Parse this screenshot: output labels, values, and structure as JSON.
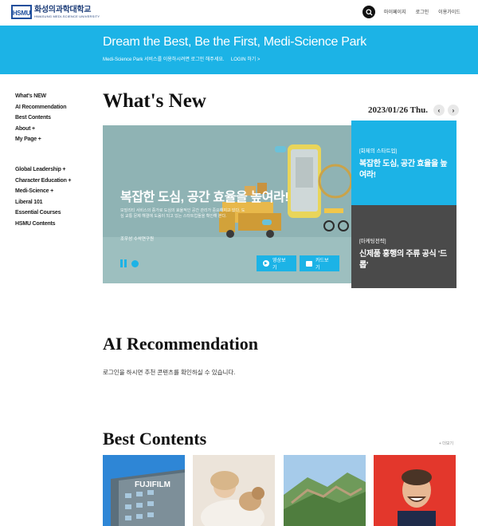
{
  "header": {
    "logo_mark": "HSMU",
    "logo_korean": "화성의과학대학교",
    "logo_english": "HWASUNG MEDI-SCIENCE UNIVERSITY",
    "links": [
      "마이페이지",
      "로그인",
      "이용가이드"
    ]
  },
  "banner": {
    "title": "Dream the Best, Be the First, Medi-Science Park",
    "subtitle": "Medi-Science Park 서비스를 이용하시려면 로그인 해주세요.     LOGIN 하기 >"
  },
  "sidebar": {
    "group1": [
      "What's NEW",
      "AI Recommendation",
      "Best Contents",
      "About +",
      "My Page +"
    ],
    "group2": [
      "Global Leadership +",
      "Character Education +",
      "Medi-Science +",
      "Liberal 101",
      "Essential Courses",
      "HSMU Contents"
    ]
  },
  "whats_new": {
    "title": "What's New",
    "date": "2023/01/26 Thu.",
    "hero": {
      "title": "복잡한 도심, 공간 효율을 높여라!",
      "description": "모빌리티 서비스의 증가로 도심의 효율적인 공간 관리가 중요해지고 있다. 도심 교통 문제 해결에 도움이 되고 있는 스타트업들을 확인해 본다.",
      "author": "조우성 수석연구원",
      "video_button": "영상보기",
      "card_button": "카드보기"
    },
    "cards": [
      {
        "tag": "[화제의 스타트업]",
        "title": "복잡한 도심, 공간 효율을 높여라!"
      },
      {
        "tag": "[마케팅전략]",
        "title": "신제품 흥행의 주류 공식 '드롭'"
      }
    ]
  },
  "ai_recommendation": {
    "title": "AI Recommendation",
    "description": "로그인을 하시면 추천 콘텐츠를 확인하실 수 있습니다."
  },
  "best_contents": {
    "title": "Best Contents",
    "more": "+ 더보기",
    "thumb1_sign": "FUJIFILM"
  },
  "colors": {
    "accent": "#1cb3e6",
    "dark_card": "#4a4a4a",
    "hero_bg": "#8fb3b4"
  }
}
